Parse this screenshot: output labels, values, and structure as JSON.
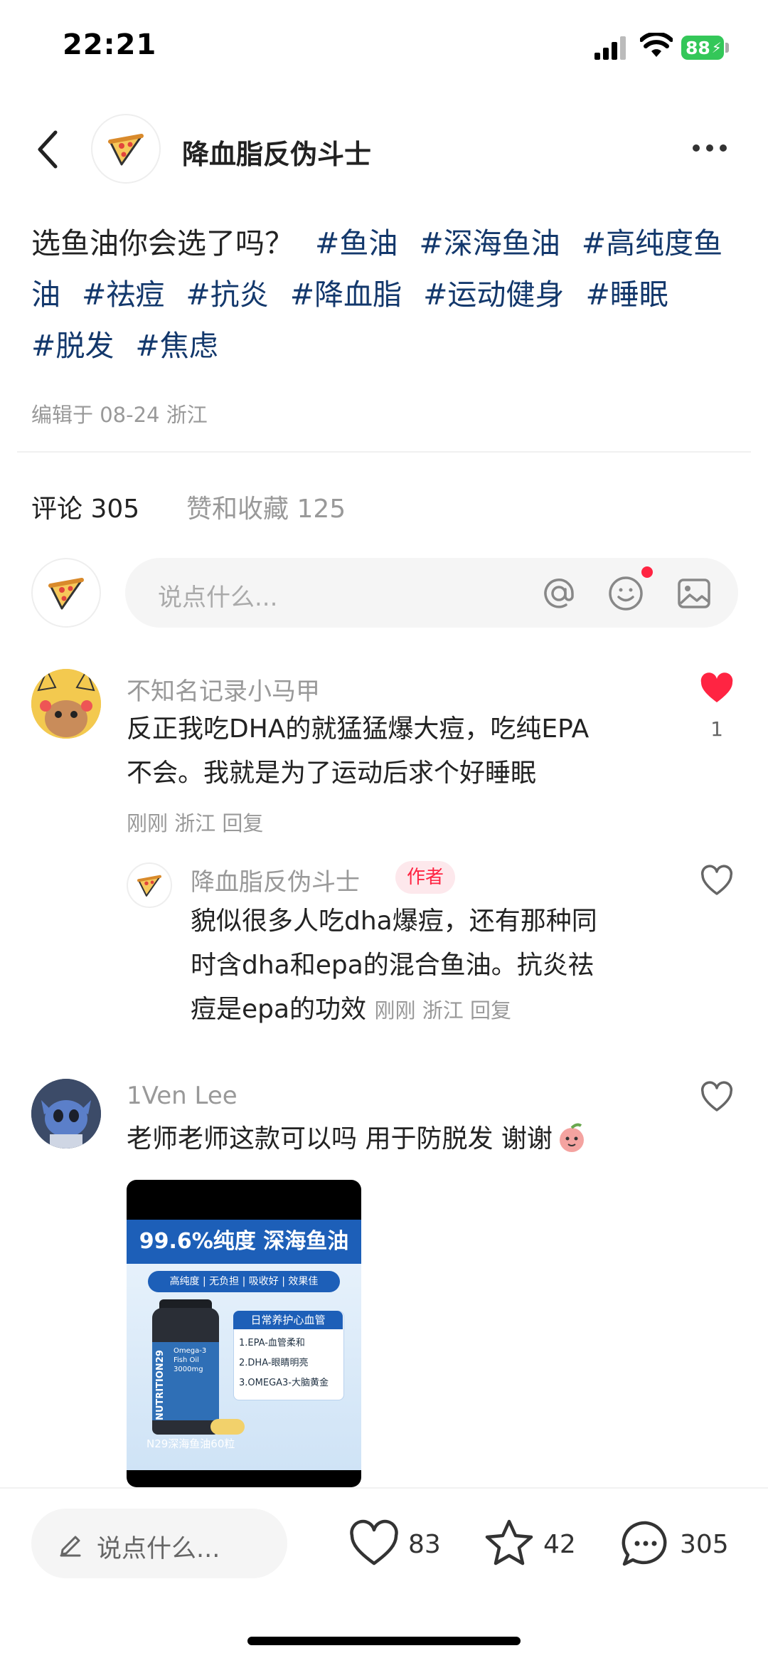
{
  "status_bar": {
    "time": "22:21",
    "battery": "88"
  },
  "header": {
    "author_name": "降血脂反伪斗士"
  },
  "post": {
    "question": "选鱼油你会选了吗？",
    "tags": [
      "#鱼油",
      "#深海鱼油",
      "#高纯度鱼油",
      "#祛痘",
      "#抗炎",
      "#降血脂",
      "#运动健身",
      "#睡眠",
      "#脱发",
      "#焦虑"
    ],
    "meta": "编辑于 08-24 浙江"
  },
  "tabs": {
    "comments": "评论 305",
    "likes_favs": "赞和收藏 125"
  },
  "comment_input": {
    "placeholder": "说点什么..."
  },
  "comments": [
    {
      "name": "不知名记录小马甲",
      "text_line1": "反正我吃DHA的就猛猛爆大痘，吃纯EPA",
      "text_line2": "不会。我就是为了运动后求个好睡眠",
      "meta": "刚刚 浙江 回复",
      "likes": "1",
      "liked": true,
      "reply": {
        "name": "降血脂反伪斗士",
        "badge": "作者",
        "text_line1": "貌似很多人吃dha爆痘，还有那种同",
        "text_line2": "时含dha和epa的混合鱼油。抗炎祛",
        "text_line3": "痘是epa的功效",
        "meta": "刚刚 浙江 回复"
      }
    },
    {
      "name": "1Ven Lee",
      "text": "老师老师这款可以吗 用于防脱发 谢谢",
      "image": {
        "banner": "99.6%纯度 深海鱼油",
        "chips": "高纯度 | 无负担 | 吸收好 | 效果佳",
        "bottle_brand": "NUTRITION29",
        "bottle_sub": "Omega-3 Fish Oil 3000mg",
        "box_title": "日常养护心血管",
        "box_lines": [
          "1.EPA-血管柔和",
          "2.DHA-眼睛明亮",
          "3.OMEGA3-大脑黄金"
        ],
        "footer": "N29深海鱼油60粒"
      }
    }
  ],
  "bottom_bar": {
    "placeholder": "说点什么...",
    "likes": "83",
    "favorites": "42",
    "comments": "305"
  },
  "colors": {
    "accent_red": "#ff2442",
    "tag_blue": "#13386c",
    "battery_green": "#34c759"
  }
}
